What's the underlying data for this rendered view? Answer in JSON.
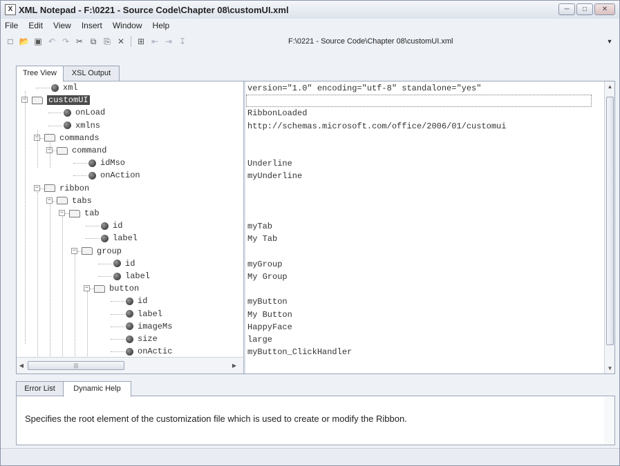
{
  "window": {
    "title": "XML Notepad - F:\\0221 - Source Code\\Chapter 08\\customUI.xml",
    "controls": [
      "minimize",
      "maximize",
      "close"
    ]
  },
  "menu": [
    "File",
    "Edit",
    "View",
    "Insert",
    "Window",
    "Help"
  ],
  "toolbar": {
    "buttons": [
      "new-icon",
      "open-icon",
      "save-icon",
      "undo-icon",
      "redo-icon",
      "cut-icon",
      "copy-icon",
      "paste-icon",
      "delete-icon",
      "insert-icon",
      "nudge-left-icon",
      "nudge-right-icon",
      "nudge-down-icon"
    ],
    "path": "F:\\0221 - Source Code\\Chapter 08\\customUI.xml"
  },
  "tabs": [
    "Tree View",
    "XSL Output"
  ],
  "tree": [
    {
      "label": "xml",
      "type": "leaf",
      "value": "version=\"1.0\" encoding=\"utf-8\" standalone=\"yes\""
    },
    {
      "label": "customUI",
      "type": "folder",
      "selected": true,
      "value": ""
    },
    {
      "label": "onLoad",
      "type": "leaf",
      "value": "RibbonLoaded"
    },
    {
      "label": "xmlns",
      "type": "leaf",
      "value": "http://schemas.microsoft.com/office/2006/01/customui"
    },
    {
      "label": "commands",
      "type": "folder",
      "value": ""
    },
    {
      "label": "command",
      "type": "folder",
      "value": ""
    },
    {
      "label": "idMso",
      "type": "leaf",
      "value": "Underline"
    },
    {
      "label": "onAction",
      "type": "leaf",
      "value": "myUnderline"
    },
    {
      "label": "ribbon",
      "type": "folder",
      "value": ""
    },
    {
      "label": "tabs",
      "type": "folder",
      "value": ""
    },
    {
      "label": "tab",
      "type": "folder",
      "value": ""
    },
    {
      "label": "id",
      "type": "leaf",
      "value": "myTab"
    },
    {
      "label": "label",
      "type": "leaf",
      "value": "My Tab"
    },
    {
      "label": "group",
      "type": "folder",
      "value": ""
    },
    {
      "label": "id",
      "type": "leaf",
      "value": "myGroup"
    },
    {
      "label": "label",
      "type": "leaf",
      "value": "My Group"
    },
    {
      "label": "button",
      "type": "folder",
      "value": ""
    },
    {
      "label": "id",
      "type": "leaf",
      "value": "myButton"
    },
    {
      "label": "label",
      "type": "leaf",
      "value": "My Button"
    },
    {
      "label": "imageMs",
      "type": "leaf",
      "value": "HappyFace"
    },
    {
      "label": "size",
      "type": "leaf",
      "value": "large"
    },
    {
      "label": "onActic",
      "type": "leaf",
      "value": "myButton_ClickHandler"
    }
  ],
  "bottom_tabs": [
    "Error List",
    "Dynamic Help"
  ],
  "help_text": "Specifies the root element of the customization file which is used to create or modify the Ribbon."
}
